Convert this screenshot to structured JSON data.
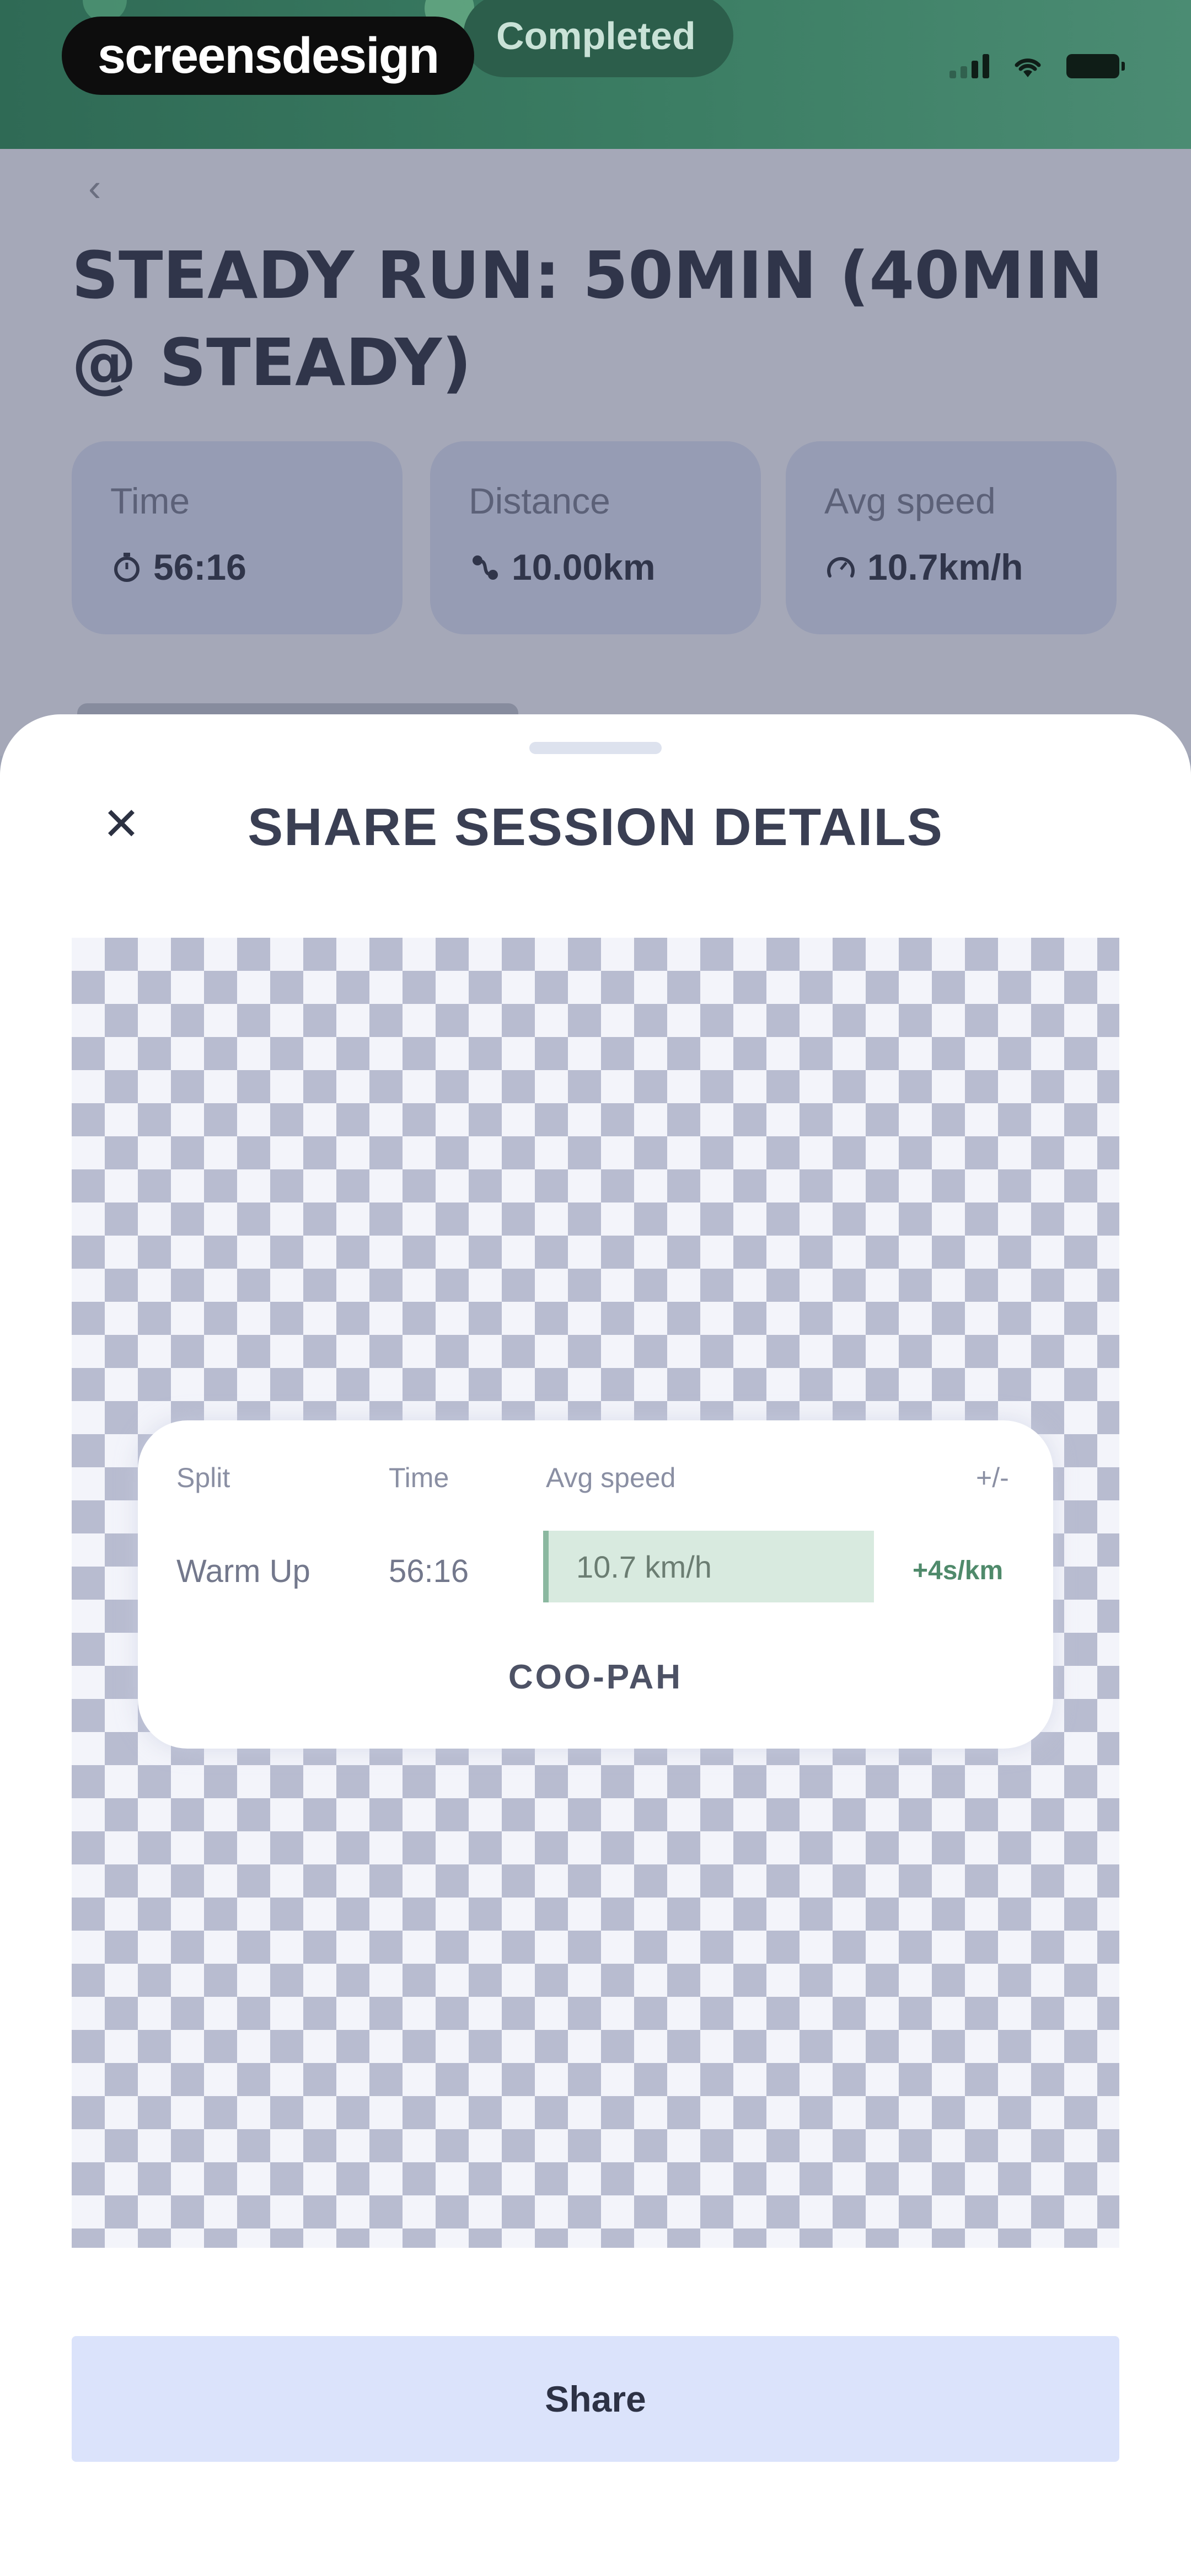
{
  "status_bar": {
    "brand": "screensdesign",
    "pill_label": "Completed"
  },
  "session": {
    "title": "STEADY RUN: 50MIN (40MIN @ STEADY)",
    "stats": [
      {
        "label": "Time",
        "value": "56:16",
        "icon": "stopwatch-icon"
      },
      {
        "label": "Distance",
        "value": "10.00km",
        "icon": "route-icon"
      },
      {
        "label": "Avg speed",
        "value": "10.7km/h",
        "icon": "speedometer-icon"
      }
    ]
  },
  "sheet": {
    "title": "SHARE SESSION DETAILS",
    "close_icon": "close-icon",
    "preview": {
      "columns": [
        "Split",
        "Time",
        "Avg speed",
        "+/-"
      ],
      "row": {
        "split": "Warm Up",
        "time": "56:16",
        "avg_speed": "10.7 km/h",
        "delta": "+4s/km"
      },
      "brand": "COO-PAH"
    },
    "share_label": "Share"
  },
  "colors": {
    "status_green": "#3b7d63",
    "share_button_bg": "#dbe3fb",
    "speed_bar": "#d8eadf",
    "delta_green": "#4f8a6b"
  }
}
